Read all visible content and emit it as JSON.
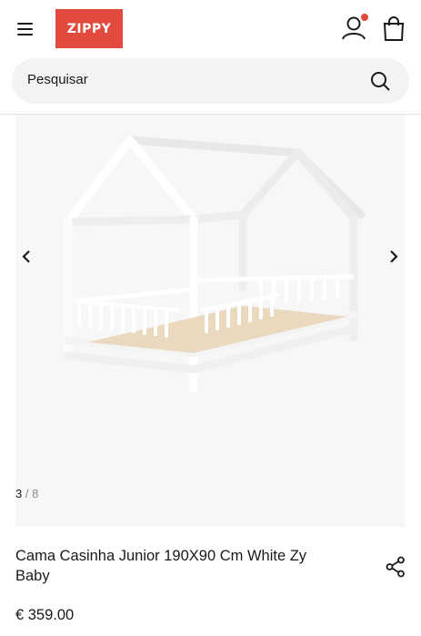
{
  "header": {
    "logo_text": "ZIPPY",
    "menu_icon": "hamburger-menu-icon",
    "account_icon": "user-icon",
    "bag_icon": "shopping-bag-icon",
    "notification_color": "#e2493f",
    "brand_color": "#e2493f"
  },
  "search": {
    "placeholder": "Pesquisar",
    "icon": "search-icon"
  },
  "gallery": {
    "current": "3",
    "separator": "/",
    "total": "8",
    "prev_icon": "chevron-left-icon",
    "next_icon": "chevron-right-icon"
  },
  "product": {
    "title": "Cama Casinha Junior 190X90 Cm White Zy Baby",
    "price": "€ 359.00",
    "share_icon": "share-icon"
  }
}
